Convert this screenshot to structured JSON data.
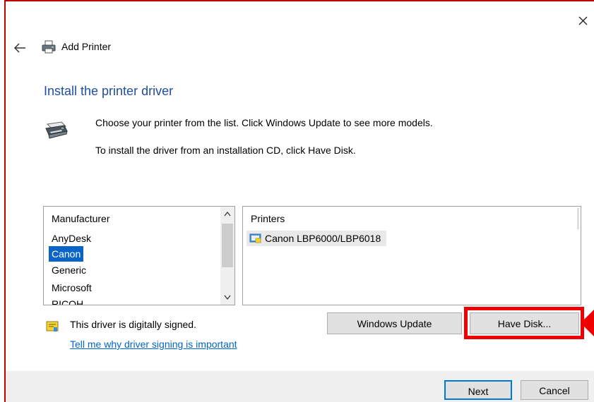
{
  "window": {
    "title": "Add Printer",
    "heading": "Install the printer driver",
    "close_icon": "close-icon",
    "back_icon": "back-arrow-icon"
  },
  "instructions": {
    "line1": "Choose your printer from the list. Click Windows Update to see more models.",
    "line2": "To install the driver from an installation CD, click Have Disk."
  },
  "manufacturer_list": {
    "header": "Manufacturer",
    "items": [
      "AnyDesk",
      "Canon",
      "Generic",
      "Microsoft",
      "RICOH"
    ],
    "selected": "Canon"
  },
  "printers_list": {
    "header": "Printers",
    "items": [
      "Canon LBP6000/LBP6018"
    ]
  },
  "signing": {
    "status_text": "This driver is digitally signed.",
    "link_text": "Tell me why driver signing is important"
  },
  "buttons": {
    "windows_update": "Windows Update",
    "have_disk": "Have Disk...",
    "next": "Next",
    "cancel": "Cancel"
  },
  "colors": {
    "heading": "#1f4e9d",
    "selection": "#0a64c8",
    "link": "#0066cc",
    "annotation": "#ee0000"
  }
}
